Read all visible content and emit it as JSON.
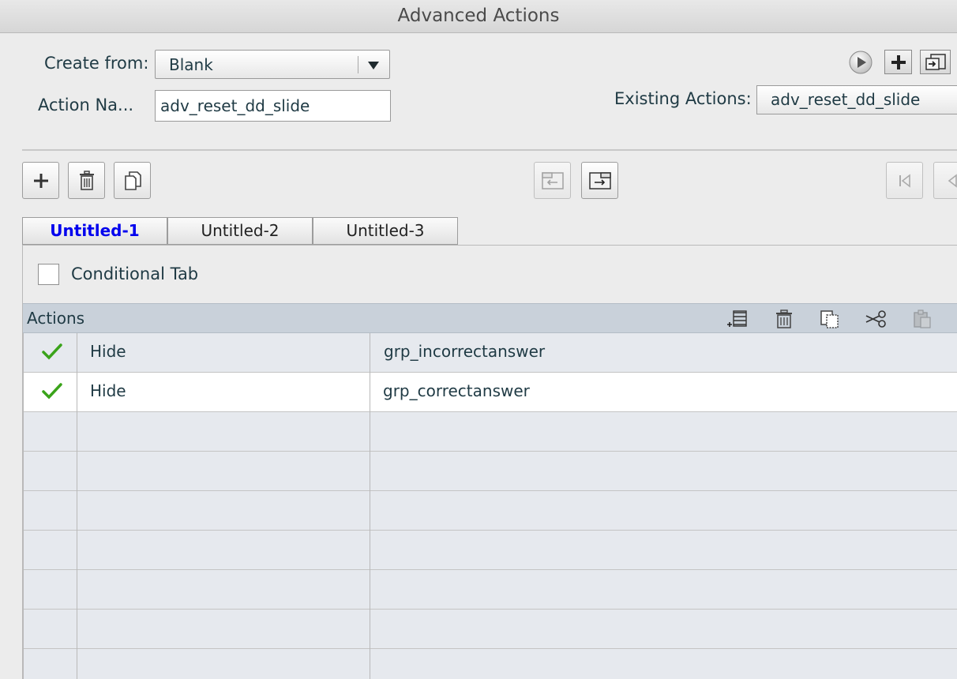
{
  "window": {
    "title": "Advanced Actions"
  },
  "form": {
    "create_from_label": "Create from:",
    "create_from_value": "Blank",
    "action_name_label": "Action Na...",
    "action_name_value": "adv_reset_dd_slide",
    "existing_actions_label": "Existing Actions:",
    "existing_actions_value": "adv_reset_dd_slide"
  },
  "tabs": [
    {
      "label": "Untitled-1",
      "active": true
    },
    {
      "label": "Untitled-2",
      "active": false
    },
    {
      "label": "Untitled-3",
      "active": false
    }
  ],
  "conditional": {
    "label": "Conditional Tab",
    "checked": false
  },
  "actions": {
    "header": "Actions",
    "rows": [
      {
        "enabled": true,
        "action": "Hide",
        "target": "grp_incorrectanswer"
      },
      {
        "enabled": true,
        "action": "Hide",
        "target": "grp_correctanswer"
      }
    ]
  },
  "colors": {
    "accent_tab": "#0000ee",
    "check": "#3aa31a",
    "header_bg": "#c9d1da"
  }
}
